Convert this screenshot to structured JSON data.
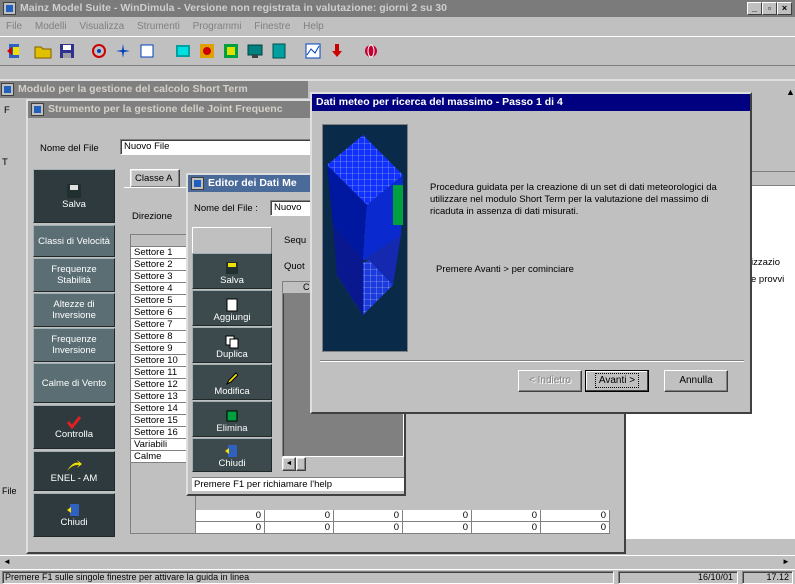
{
  "app": {
    "title": "Mainz Model Suite - WinDimula - Versione non registrata in valutazione: giorni 2 su 30",
    "menu": [
      "File",
      "Modelli",
      "Visualizza",
      "Strumenti",
      "Programmi",
      "Finestre",
      "Help"
    ]
  },
  "mdi_child": {
    "title": "Modulo per la gestione del calcolo Short Term"
  },
  "strumento": {
    "title": "Strumento per la gestione delle Joint Frequenc",
    "nome_file_label": "Nome del File",
    "nome_file_value": "Nuovo File",
    "tab": "Classe A",
    "direzione_label": "Direzione",
    "sidebar": [
      {
        "id": "salva",
        "label": "Salva"
      },
      {
        "id": "classi",
        "label": "Classi di Velocità"
      },
      {
        "id": "frequenze-stabilita",
        "label": "Frequenze Stabilità"
      },
      {
        "id": "altezze",
        "label": "Altezze di Inversione"
      },
      {
        "id": "frequenze-inversione",
        "label": "Frequenze Inversione"
      },
      {
        "id": "calme",
        "label": "Calme di Vento"
      },
      {
        "id": "controlla",
        "label": "Controlla"
      },
      {
        "id": "enel",
        "label": "ENEL - AM"
      },
      {
        "id": "chiudi",
        "label": "Chiudi"
      }
    ],
    "rows": [
      "Settore 1",
      "Settore 2",
      "Settore 3",
      "Settore 4",
      "Settore 5",
      "Settore 6",
      "Settore 7",
      "Settore 8",
      "Settore 9",
      "Settore 10",
      "Settore 11",
      "Settore 12",
      "Settore 13",
      "Settore 14",
      "Settore 15",
      "Settore 16",
      "Variabili",
      "Calme"
    ],
    "bottom_values": {
      "variabili": [
        "0",
        "0",
        "0",
        "0",
        "0",
        "0"
      ],
      "calme": [
        "0",
        "0",
        "0",
        "0",
        "0",
        "0"
      ]
    }
  },
  "editor": {
    "title": "Editor dei Dati Me",
    "nome_file_label": "Nome del File :",
    "nome_file_value": "Nuovo",
    "seq_label": "Sequ",
    "quot_label": "Quot",
    "col_label": "C",
    "status": "Premere F1 per richiamare l'help",
    "buttons": [
      "Salva",
      "Aggiungi",
      "Duplica",
      "Modifica",
      "Elimina",
      "Chiudi"
    ]
  },
  "right_fragments": {
    "item1": "izzazio",
    "item2": "e provvi"
  },
  "wizard": {
    "title": "Dati meteo per ricerca del massimo - Passo 1 di 4",
    "description": "Procedura guidata per la creazione di un set di dati meteorologici da utilizzare nel modulo Short Term per la valutazione del massimo di ricaduta in assenza di dati misurati.",
    "instruction": "Premere Avanti > per cominciare",
    "back_label": "< Indietro",
    "next_label": "Avanti >",
    "cancel_label": "Annulla"
  },
  "statusbar": {
    "message": "Premere F1 sulle singole finestre per attivare la guida in linea",
    "date": "16/10/01",
    "time": "17.12"
  },
  "colors": {
    "active_title": "#000080",
    "inactive_title": "#808080",
    "face": "#c0c0c0",
    "sidebar": "#5a6e74"
  }
}
